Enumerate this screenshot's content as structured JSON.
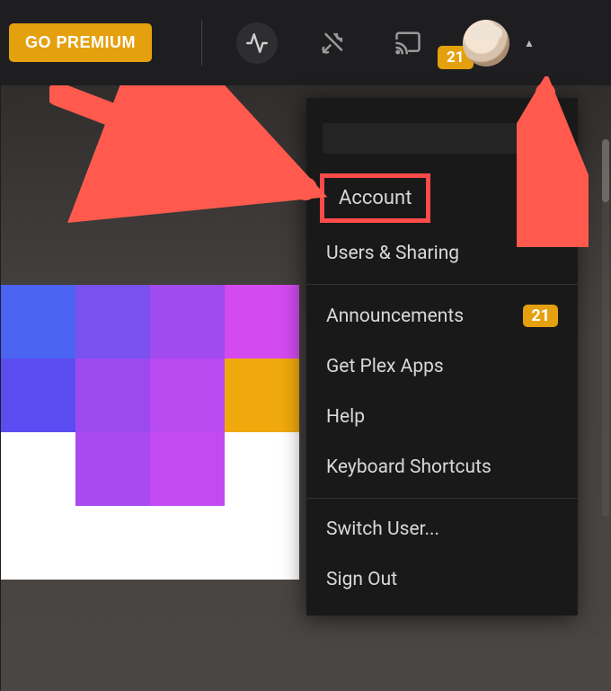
{
  "toolbar": {
    "go_premium_label": "GO PREMIUM",
    "notification_count": "21"
  },
  "menu": {
    "sections": [
      [
        "Account",
        "Users & Sharing"
      ],
      [
        "Announcements",
        "Get Plex Apps",
        "Help",
        "Keyboard Shortcuts"
      ],
      [
        "Switch User...",
        "Sign Out"
      ]
    ],
    "announcements_badge": "21"
  },
  "colors": {
    "accent": "#e5a00d",
    "highlight": "#ff4a4a"
  }
}
